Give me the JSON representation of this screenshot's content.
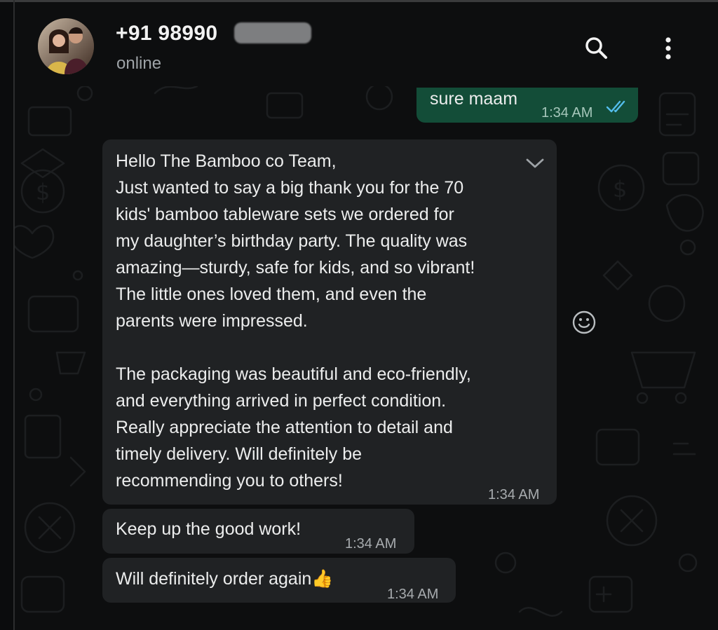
{
  "header": {
    "contact_name": "+91 98990",
    "status": "online",
    "avatar_icon": "avatar-photo",
    "search_icon": "search-icon",
    "menu_icon": "more-vertical-icon"
  },
  "messages": [
    {
      "direction": "outgoing",
      "text": "sure maam",
      "time": "1:34 AM",
      "status": "read"
    },
    {
      "direction": "incoming",
      "text": "Hello The Bamboo co Team,\nJust wanted to say a big thank you for the 70\nkids' bamboo tableware sets we ordered for\nmy daughter’s birthday party. The quality was\namazing—sturdy, safe for kids, and so vibrant!\nThe little ones loved them, and even the\nparents were impressed.\n\nThe packaging was beautiful and eco-friendly,\nand everything arrived in perfect condition.\nReally appreciate the attention to detail and\ntimely delivery. Will definitely be\nrecommending you to others!",
      "time": "1:34 AM"
    },
    {
      "direction": "incoming",
      "text": "Keep up the good work!",
      "time": "1:34 AM"
    },
    {
      "direction": "incoming",
      "text": "Will definitely order again👍",
      "time": "1:34 AM"
    }
  ],
  "colors": {
    "incoming_bubble": "#202224",
    "outgoing_bubble": "#134d38",
    "read_ticks": "#53bdeb",
    "background": "#0d0e0f"
  }
}
